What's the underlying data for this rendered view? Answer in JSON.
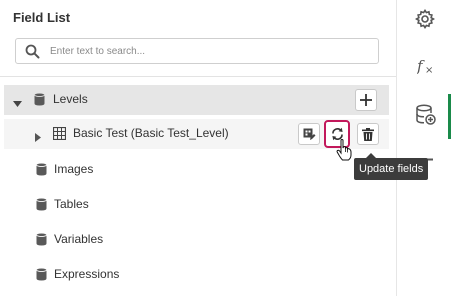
{
  "panel": {
    "title": "Field List",
    "search": {
      "placeholder": "Enter text to search..."
    }
  },
  "tree": {
    "root": {
      "label": "Levels",
      "icon": "database-icon",
      "expanded": true
    },
    "child": {
      "label": "Basic Test (Basic Test_Level)",
      "icon": "table-grid-icon"
    },
    "items": [
      {
        "label": "Images",
        "icon": "database-icon"
      },
      {
        "label": "Tables",
        "icon": "database-icon"
      },
      {
        "label": "Variables",
        "icon": "database-icon"
      },
      {
        "label": "Expressions",
        "icon": "database-icon"
      }
    ]
  },
  "row_actions": {
    "add_icon": "plus-icon",
    "edit_icon": "edit-field-icon",
    "refresh_icon": "refresh-icon",
    "delete_icon": "trash-icon"
  },
  "tooltip": {
    "text": "Update fields"
  },
  "rail": {
    "items": [
      {
        "icon": "gear-icon",
        "active": false
      },
      {
        "icon": "function-icon",
        "active": false
      },
      {
        "icon": "database-add-icon",
        "active": true
      },
      {
        "icon": "list-icon",
        "active": false
      }
    ]
  },
  "colors": {
    "accent_active_border": "#c2185b",
    "rail_active_indicator": "#1a8a4a",
    "selected_row": "#e6e6e6",
    "tooltip_bg": "#3c3c3c"
  }
}
